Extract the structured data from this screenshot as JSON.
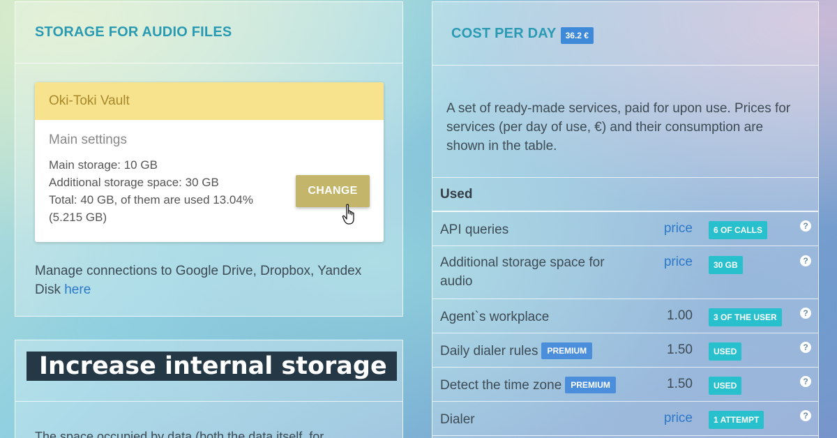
{
  "storage": {
    "title": "STORAGE FOR AUDIO FILES",
    "vault_name": "Oki-Toki Vault",
    "main_settings": "Main settings",
    "main_storage": "Main storage: 10 GB",
    "additional_storage": "Additional storage space: 30 GB",
    "total": "Total: 40 GB, of them are used 13.04% (5.215 GB)",
    "change_label": "CHANGE",
    "manage_text": "Manage connections to Google Drive, Dropbox, Yandex Disk ",
    "manage_link": "here"
  },
  "increase": {
    "title": "Increase internal storage",
    "text": "The space occupied by data (both the data itself, for"
  },
  "cost": {
    "title": "COST PER DAY",
    "badge": "36.2 €",
    "description": "A set of ready-made services, paid for upon use. Prices for services (per day of use, €) and their consumption are shown in the table.",
    "used_header": "Used",
    "rows": [
      {
        "name": "API queries",
        "premium": "",
        "price": "price",
        "usage": "6 OF CALLS"
      },
      {
        "name": "Additional storage space for audio",
        "premium": "",
        "price": "price",
        "usage": "30 GB"
      },
      {
        "name": "Agent`s workplace",
        "premium": "",
        "price": "1.00",
        "usage": "3 OF THE USER"
      },
      {
        "name": "Daily dialer rules",
        "premium": "PREMIUM",
        "price": "1.50",
        "usage": "USED"
      },
      {
        "name": "Detect the time zone",
        "premium": "PREMIUM",
        "price": "1.50",
        "usage": "USED"
      },
      {
        "name": "Dialer",
        "premium": "",
        "price": "price",
        "usage": "1 ATTEMPT"
      }
    ],
    "help_glyph": "?"
  },
  "colors": {
    "accent": "#2a9ab3",
    "vault_header": "#f7e28e",
    "change_button": "#c3b56a",
    "usage_badge": "#28c0cc",
    "premium_badge": "#4b8fdc",
    "link": "#2c78c9"
  },
  "icons": [
    "hand-cursor-icon",
    "help-icon"
  ]
}
